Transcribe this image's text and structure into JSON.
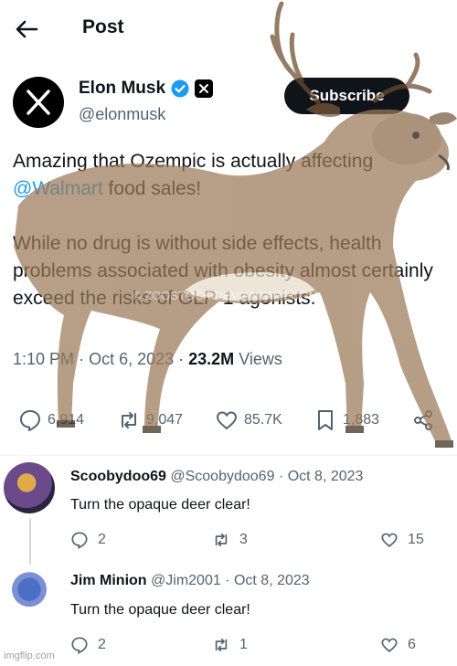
{
  "header": {
    "title": "Post"
  },
  "author": {
    "name": "Elon Musk",
    "handle": "@elonmusk",
    "subscribe_label": "Subscribe"
  },
  "post": {
    "line1_pre": "Amazing that Ozempic is actually affecting",
    "mention": "@Walmart",
    "line2_post": " food sales!",
    "paragraph2": "While no drug is without side effects, health problems associated with obesity almost certainly exceed the risks of GLP-1 agonists.",
    "time": "1:10 PM",
    "date": "Oct 6, 2023",
    "views_count": "23.2M",
    "views_label": "Views",
    "replies": "6,914",
    "reposts": "9,047",
    "likes": "85.7K",
    "bookmarks": "1,883"
  },
  "replies": [
    {
      "name": "Scoobydoo69",
      "handle": "@Scoobydoo69",
      "date": "Oct 8, 2023",
      "text": "Turn the opaque deer clear!",
      "replies": "2",
      "reposts": "3",
      "likes": "15"
    },
    {
      "name": "Jim Minion",
      "handle": "@Jim2001",
      "date": "Oct 8, 2023",
      "text": "Turn the opaque deer clear!",
      "replies": "2",
      "reposts": "1",
      "likes": "6"
    }
  ],
  "overlay": {
    "watermark": "imgflip.com",
    "deer_watermark": "© ZOOSTOCK.DEVIANTART.COM"
  },
  "colors": {
    "accent": "#1d9bf0",
    "text": "#0f1419",
    "muted": "#536471"
  }
}
